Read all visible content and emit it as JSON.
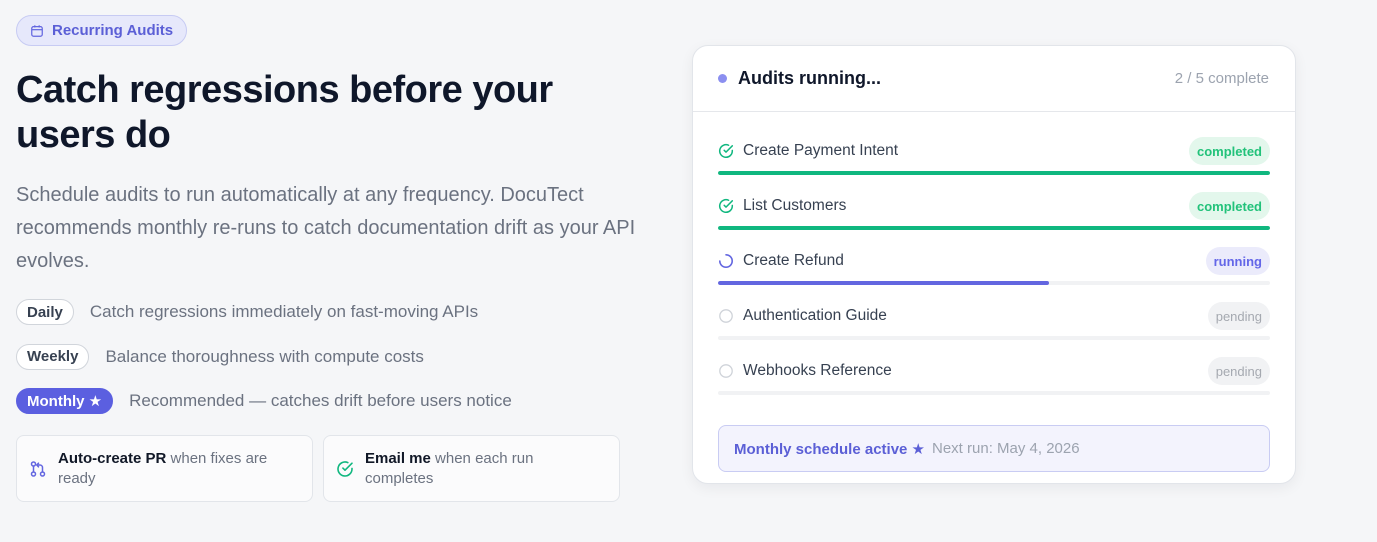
{
  "badge": {
    "label": "Recurring Audits",
    "icon": "calendar-icon"
  },
  "hero": {
    "title": "Catch regressions before your users do",
    "description": "Schedule audits to run automatically at any frequency. DocuTect recommends monthly re-runs to catch documentation drift as your API evolves."
  },
  "frequencies": [
    {
      "label": "Daily",
      "description": "Catch regressions immediately on fast-moving APIs",
      "active": false
    },
    {
      "label": "Weekly",
      "description": "Balance thoroughness with compute costs",
      "active": false
    },
    {
      "label": "Monthly ★",
      "description": "Recommended — catches drift before users notice",
      "active": true
    }
  ],
  "features": [
    {
      "strong": "Auto-create PR",
      "rest": " when fixes are ready",
      "icon": "git-pull-request-icon"
    },
    {
      "strong": "Email me",
      "rest": " when each run completes",
      "icon": "check-circle-icon"
    }
  ],
  "panel": {
    "title": "Audits running...",
    "count": "2 / 5 complete",
    "tasks": [
      {
        "name": "Create Payment Intent",
        "status": "completed",
        "progress": 1.0
      },
      {
        "name": "List Customers",
        "status": "completed",
        "progress": 1.0
      },
      {
        "name": "Create Refund",
        "status": "running",
        "progress": 0.6
      },
      {
        "name": "Authentication Guide",
        "status": "pending",
        "progress": 0
      },
      {
        "name": "Webhooks Reference",
        "status": "pending",
        "progress": 0
      }
    ],
    "footer": {
      "strong": "Monthly schedule active ★",
      "next": "Next run: May 4, 2026"
    }
  },
  "colors": {
    "accent": "#5b5fe0",
    "success": "#10b77f",
    "running": "#6366e0",
    "pending": "#a5a9b0"
  }
}
